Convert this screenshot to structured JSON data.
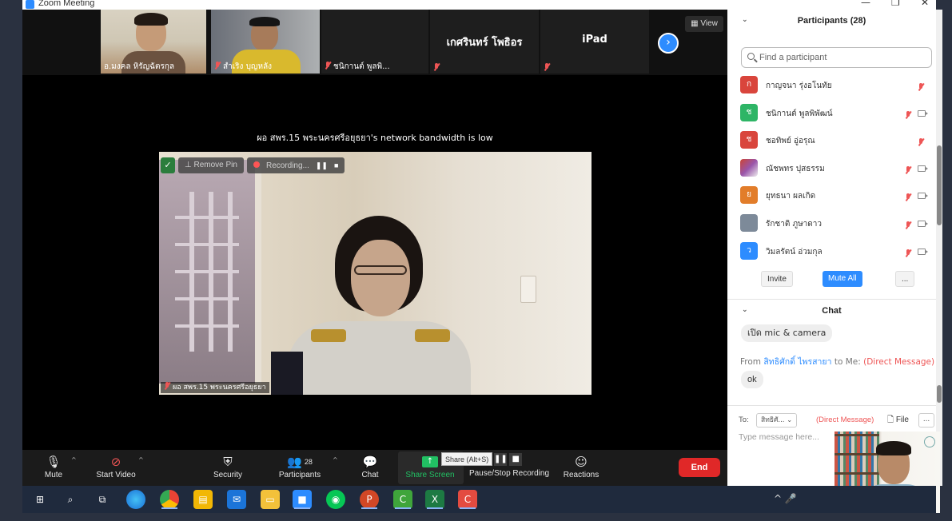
{
  "window": {
    "title": "Zoom Meeting",
    "minimize": "—",
    "restore": "❐",
    "close": "✕"
  },
  "gallery": {
    "tiles": [
      {
        "name": "อ.มงคล หิรัญฉัตรกุล",
        "type": "video",
        "muted": false
      },
      {
        "name": "สำเริง บุญหลัง",
        "type": "video",
        "muted": true
      },
      {
        "name": "ชนิกานต์ พูลพิ...",
        "type": "video",
        "muted": true
      },
      {
        "name": "เกศรินทร์ โพธิอร",
        "type": "name",
        "muted": true
      },
      {
        "name": "iPad",
        "type": "name",
        "muted": true
      }
    ],
    "next_icon": "›",
    "view_label": "View"
  },
  "notice": "ผอ สพร.15 พระนครศรีอยุธยา's network bandwidth is low",
  "active_speaker": {
    "remove_pin_label": "Remove Pin",
    "recording_label": "Recording...",
    "name_label": "ผอ สพร.15 พระนครศรีอยุธยา"
  },
  "toolbar": {
    "mute": "Mute",
    "start_video": "Start Video",
    "security": "Security",
    "participants": "Participants",
    "participants_count": "28",
    "chat": "Chat",
    "share_screen": "Share Screen",
    "share_tooltip": "Share (Alt+S)",
    "pause_stop": "Pause/Stop Recording",
    "reactions": "Reactions",
    "end": "End"
  },
  "participants_panel": {
    "title": "Participants (28)",
    "search_placeholder": "Find a participant",
    "items": [
      {
        "initial": "ก",
        "name": "กาญจนา รุ่งอโนทัย",
        "color": "#d9453c",
        "video": false
      },
      {
        "initial": "ช",
        "name": "ชนิกานต์ พูลพิพัฒน์",
        "color": "#2eb566",
        "video": true
      },
      {
        "initial": "ช",
        "name": "ชอทิพย์ อู่อรุณ",
        "color": "#d9453c",
        "video": false
      },
      {
        "initial": "",
        "name": "ณัชพทร ปุสธรรม",
        "color": "#9a4f6a",
        "video": true
      },
      {
        "initial": "ย",
        "name": "ยุทธนา ผลเกิด",
        "color": "#e27d2a",
        "video": true
      },
      {
        "initial": "",
        "name": "รักชาติ ภูษาดาว",
        "color": "#7d8a99",
        "video": true
      },
      {
        "initial": "ว",
        "name": "วิมลรัตน์ อ่วมกุล",
        "color": "#2d8cff",
        "video": true
      }
    ],
    "invite": "Invite",
    "mute_all": "Mute All",
    "more": "..."
  },
  "chat_panel": {
    "title": "Chat",
    "message_1": "เปิด mic & camera",
    "from_prefix": "From",
    "from_name": "สิทธิศักดิ์ ไพรสายา",
    "to_me": "to Me:",
    "direct_tag": "(Direct Message)",
    "message_2": "ok",
    "to_label": "To:",
    "to_value": "สิทธิศั...",
    "file_label": "File",
    "more": "...",
    "input_placeholder": "Type message here..."
  },
  "taskbar": {
    "apps": [
      "start-icon",
      "search-icon",
      "task-view-icon",
      "edge-icon",
      "chrome-icon",
      "store-icon",
      "mail-icon",
      "explorer-icon",
      "zoom-icon",
      "line-icon",
      "powerpoint-icon",
      "camtasia-icon",
      "excel-icon",
      "camtasia-recorder-icon"
    ]
  }
}
